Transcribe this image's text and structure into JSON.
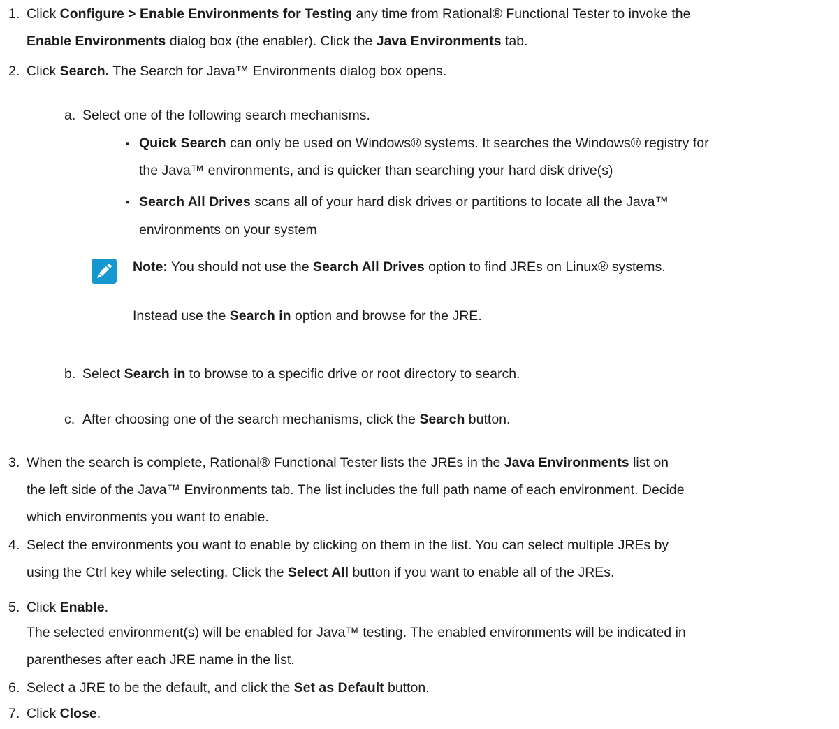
{
  "steps": [
    {
      "num": "1.",
      "l1": {
        "t1": "Click ",
        "b1": "Configure  > Enable Environments for Testing",
        "t2": " any time from Rational® Functional Tester to invoke the"
      },
      "l2": {
        "b1": "Enable Environments",
        "t1": " dialog box (the enabler). Click the ",
        "b2": "Java Environments",
        "t2": " tab."
      }
    },
    {
      "num": "2.",
      "l1": {
        "t1": "Click ",
        "b1": "Search.",
        "t2": " The Search for Java™ Environments dialog box opens."
      },
      "substeps": [
        {
          "num": "a.",
          "text": "Select one of the following search mechanisms.",
          "bullets": [
            {
              "l1": {
                "b1": "Quick Search",
                "t1": " can only be used on Windows® systems. It searches the Windows® registry for"
              },
              "l2": "the Java™ environments, and is quicker than searching your hard disk drive(s)"
            },
            {
              "l1": {
                "b1": "Search All Drives",
                "t1": " scans all of your hard disk drives or partitions to locate all the Java™"
              },
              "l2": "environments on your system"
            }
          ],
          "note": {
            "l1": {
              "b1": "Note:",
              "t1": " You should not use the ",
              "b2": "Search All Drives",
              "t2": " option to find JREs on Linux® systems."
            },
            "l2": {
              "t1": "Instead use the ",
              "b1": "Search in",
              "t2": " option and browse for the JRE."
            }
          }
        },
        {
          "num": "b.",
          "t1": "Select ",
          "b1": "Search in",
          "t2": " to browse to a specific drive or root directory to search."
        },
        {
          "num": "c.",
          "t1": "After choosing one of the search mechanisms, click the ",
          "b1": "Search",
          "t2": " button."
        }
      ]
    },
    {
      "num": "3.",
      "l1": {
        "t1": "When the search is complete, Rational® Functional Tester lists the JREs in the ",
        "b1": "Java Environments",
        "t2": " list on"
      },
      "l2": "the left side of the Java™ Environments tab. The list includes the full path name of each environment. Decide",
      "l3": "which environments you want to enable."
    },
    {
      "num": "4.",
      "l1": "Select the environments you want to enable by clicking on them in the list. You can select multiple JREs by",
      "l2": {
        "t1": "using the Ctrl key while selecting. Click the ",
        "b1": "Select All",
        "t2": " button if you want to enable all of the JREs."
      }
    },
    {
      "num": "5.",
      "l1": {
        "t1": "Click ",
        "b1": "Enable",
        "t2": "."
      },
      "l2": "The selected environment(s) will be enabled for Java™ testing. The enabled environments will be indicated in",
      "l3": "parentheses after each JRE name in the list."
    },
    {
      "num": "6.",
      "l1": {
        "t1": "Select a JRE to be the default, and click the ",
        "b1": "Set as Default",
        "t2": " button."
      }
    },
    {
      "num": "7.",
      "l1": {
        "t1": "Click ",
        "b1": "Close",
        "t2": "."
      }
    }
  ],
  "icons": {
    "note": "pencil-icon"
  },
  "colors": {
    "text": "#1c1c1c",
    "note_icon_bg": "#1598cf"
  }
}
